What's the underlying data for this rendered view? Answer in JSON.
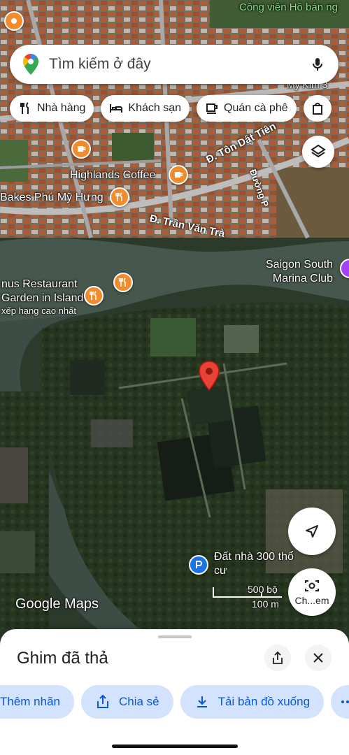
{
  "search": {
    "placeholder": "Tìm kiếm ở đây"
  },
  "chips": [
    {
      "label": "Nhà hàng",
      "icon": "fork-knife-icon"
    },
    {
      "label": "Khách sạn",
      "icon": "bed-icon"
    },
    {
      "label": "Quán cà phê",
      "icon": "coffee-cup-icon"
    }
  ],
  "map_labels": {
    "park": "Công viên Hồ bán ng",
    "highlands": "Highlands Coffee",
    "bakes": "Bakes Phú Mỹ Hưng",
    "ton_dat_tien": "Đ. Tôn Dật Tiên",
    "duong_p": "Đường P",
    "tran_van_tra": "Đ. Trần Văn Trà",
    "my_kim": "My Kim 3",
    "marina_line1": "Saigon South",
    "marina_line2": "Marina Club",
    "restaurant_line1": "nus Restaurant",
    "restaurant_line2": "Garden in Island",
    "restaurant_line3": "xếp hạng cao nhất",
    "land_line1": "Đất nhà 300 thổ",
    "land_line2": "cư"
  },
  "scale": {
    "imperial": "500 bộ",
    "metric": "100 m"
  },
  "attribution": "Google Maps",
  "camera_button_label": "Ch...em",
  "sheet": {
    "title": "Ghim đã thả",
    "actions": [
      {
        "label": "Thêm nhãn"
      },
      {
        "label": "Chia sẻ",
        "icon": "share-icon"
      },
      {
        "label": "Tải bản đồ xuống",
        "icon": "download-icon"
      }
    ]
  },
  "colors": {
    "pin_red": "#ea4335",
    "poi_orange": "#f28b2c",
    "chip_active_bg": "#d3e3fd",
    "accent_blue": "#0b57d0"
  }
}
